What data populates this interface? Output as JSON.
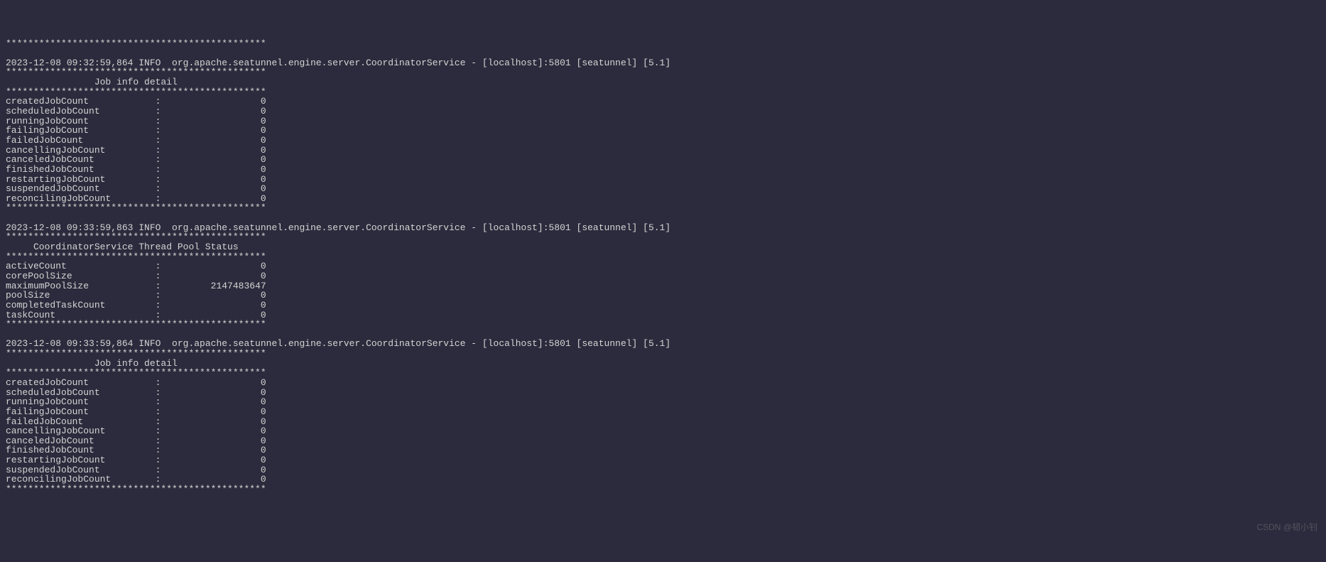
{
  "star_top": "***********************************************",
  "star_line": "***********************************************",
  "blocks": [
    {
      "header": "2023-12-08 09:32:59,864 INFO  org.apache.seatunnel.engine.server.CoordinatorService - [localhost]:5801 [seatunnel] [5.1] ",
      "title": "                Job info detail                ",
      "rows": [
        {
          "k": "createdJobCount            ",
          "v": "                  0"
        },
        {
          "k": "scheduledJobCount          ",
          "v": "                  0"
        },
        {
          "k": "runningJobCount            ",
          "v": "                  0"
        },
        {
          "k": "failingJobCount            ",
          "v": "                  0"
        },
        {
          "k": "failedJobCount             ",
          "v": "                  0"
        },
        {
          "k": "cancellingJobCount         ",
          "v": "                  0"
        },
        {
          "k": "canceledJobCount           ",
          "v": "                  0"
        },
        {
          "k": "finishedJobCount           ",
          "v": "                  0"
        },
        {
          "k": "restartingJobCount         ",
          "v": "                  0"
        },
        {
          "k": "suspendedJobCount          ",
          "v": "                  0"
        },
        {
          "k": "reconcilingJobCount        ",
          "v": "                  0"
        }
      ]
    },
    {
      "header": "2023-12-08 09:33:59,863 INFO  org.apache.seatunnel.engine.server.CoordinatorService - [localhost]:5801 [seatunnel] [5.1] ",
      "title": "     CoordinatorService Thread Pool Status     ",
      "rows": [
        {
          "k": "activeCount                ",
          "v": "                  0"
        },
        {
          "k": "corePoolSize               ",
          "v": "                  0"
        },
        {
          "k": "maximumPoolSize            ",
          "v": "         2147483647"
        },
        {
          "k": "poolSize                   ",
          "v": "                  0"
        },
        {
          "k": "completedTaskCount         ",
          "v": "                  0"
        },
        {
          "k": "taskCount                  ",
          "v": "                  0"
        }
      ]
    },
    {
      "header": "2023-12-08 09:33:59,864 INFO  org.apache.seatunnel.engine.server.CoordinatorService - [localhost]:5801 [seatunnel] [5.1] ",
      "title": "                Job info detail                ",
      "rows": [
        {
          "k": "createdJobCount            ",
          "v": "                  0"
        },
        {
          "k": "scheduledJobCount          ",
          "v": "                  0"
        },
        {
          "k": "runningJobCount            ",
          "v": "                  0"
        },
        {
          "k": "failingJobCount            ",
          "v": "                  0"
        },
        {
          "k": "failedJobCount             ",
          "v": "                  0"
        },
        {
          "k": "cancellingJobCount         ",
          "v": "                  0"
        },
        {
          "k": "canceledJobCount           ",
          "v": "                  0"
        },
        {
          "k": "finishedJobCount           ",
          "v": "                  0"
        },
        {
          "k": "restartingJobCount         ",
          "v": "                  0"
        },
        {
          "k": "suspendedJobCount          ",
          "v": "                  0"
        },
        {
          "k": "reconcilingJobCount        ",
          "v": "                  0"
        }
      ]
    }
  ],
  "watermark": "CSDN @韧小钊"
}
